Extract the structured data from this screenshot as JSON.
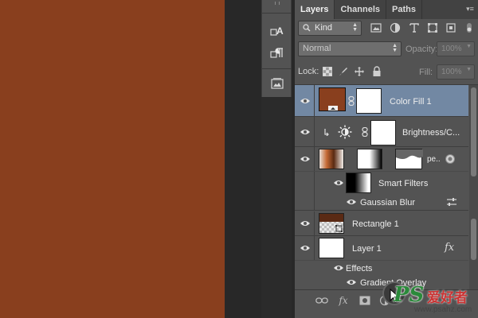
{
  "canvas": {
    "color": "#893f1e"
  },
  "toolstrip": {
    "tools": [
      "character-style-icon",
      "paragraph-style-icon",
      "layer-comps-icon"
    ]
  },
  "panel": {
    "tabs": [
      {
        "label": "Layers",
        "active": true
      },
      {
        "label": "Channels",
        "active": false
      },
      {
        "label": "Paths",
        "active": false
      }
    ],
    "filter": {
      "kind_label": "Kind",
      "icons": [
        "image-filter-icon",
        "adjustment-filter-icon",
        "type-filter-icon",
        "shape-filter-icon",
        "smart-object-filter-icon"
      ]
    },
    "blend": {
      "mode": "Normal",
      "opacity_label": "Opacity:",
      "opacity_value": "100%"
    },
    "lock": {
      "label": "Lock:",
      "icons": [
        "lock-transparent-icon",
        "lock-image-icon",
        "lock-position-icon",
        "lock-all-icon"
      ],
      "fill_label": "Fill:",
      "fill_value": "100%"
    },
    "layers": [
      {
        "name": "Color Fill 1",
        "selected": true
      },
      {
        "name": "Brightness/C...",
        "selected": false
      },
      {
        "name": "pe..",
        "selected": false
      },
      {
        "name": "Smart Filters",
        "selected": false
      },
      {
        "name": "Gaussian Blur",
        "selected": false
      },
      {
        "name": "Rectangle 1",
        "selected": false
      },
      {
        "name": "Layer 1",
        "fx": "fx",
        "selected": false
      },
      {
        "name": "Effects",
        "selected": false
      },
      {
        "name": "Gradient Overlay",
        "selected": false
      }
    ],
    "bottom_icons": [
      "link-layers-icon",
      "fx-icon",
      "mask-icon",
      "adjustment-icon"
    ],
    "fx_symbol": "fx"
  },
  "watermark": {
    "logo": "PS",
    "text": "爱好者",
    "url": "www.psahz.com"
  }
}
